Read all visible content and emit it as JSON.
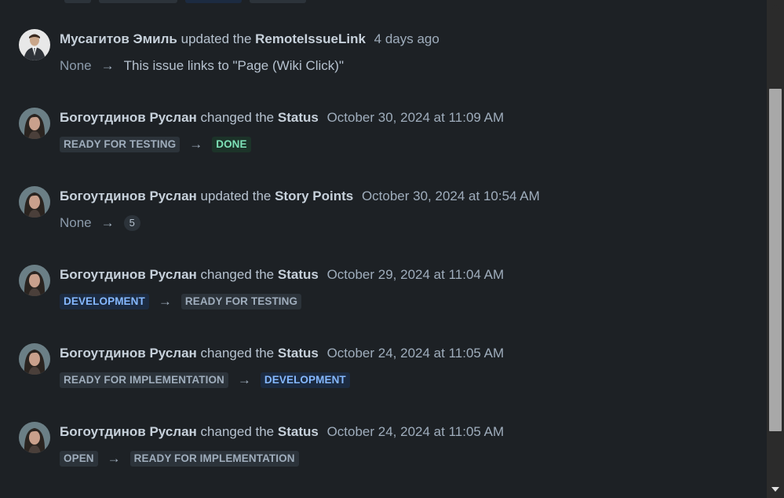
{
  "arrow": "→",
  "entries": [
    {
      "author": "Мусагитов Эмиль",
      "verb": "updated the",
      "field": "RemoteIssueLink",
      "timestamp": "4 days ago",
      "from": "None",
      "to": "This issue links to \"Page (Wiki Click)\"",
      "avatar": "avatar-suit-man"
    },
    {
      "author": "Богоутдинов Руслан",
      "verb": "changed the",
      "field": "Status",
      "timestamp": "October 30, 2024 at 11:09 AM",
      "from": "READY FOR TESTING",
      "to": "DONE",
      "avatar": "avatar-woman"
    },
    {
      "author": "Богоутдинов Руслан",
      "verb": "updated the",
      "field": "Story Points",
      "timestamp": "October 30, 2024 at 10:54 AM",
      "from": "None",
      "to": "5",
      "avatar": "avatar-woman"
    },
    {
      "author": "Богоутдинов Руслан",
      "verb": "changed the",
      "field": "Status",
      "timestamp": "October 29, 2024 at 11:04 AM",
      "from": "DEVELOPMENT",
      "to": "READY FOR TESTING",
      "avatar": "avatar-woman"
    },
    {
      "author": "Богоутдинов Руслан",
      "verb": "changed the",
      "field": "Status",
      "timestamp": "October 24, 2024 at 11:05 AM",
      "from": "READY FOR IMPLEMENTATION",
      "to": "DEVELOPMENT",
      "avatar": "avatar-woman"
    },
    {
      "author": "Богоутдинов Руслан",
      "verb": "changed the",
      "field": "Status",
      "timestamp": "October 24, 2024 at 11:05 AM",
      "from": "OPEN",
      "to": "READY FOR IMPLEMENTATION",
      "avatar": "avatar-woman"
    }
  ],
  "colors": {
    "background": "#1d2125",
    "status_grey": "#9fadbc",
    "status_green": "#7ee2b8",
    "status_blue": "#85b8ff"
  }
}
